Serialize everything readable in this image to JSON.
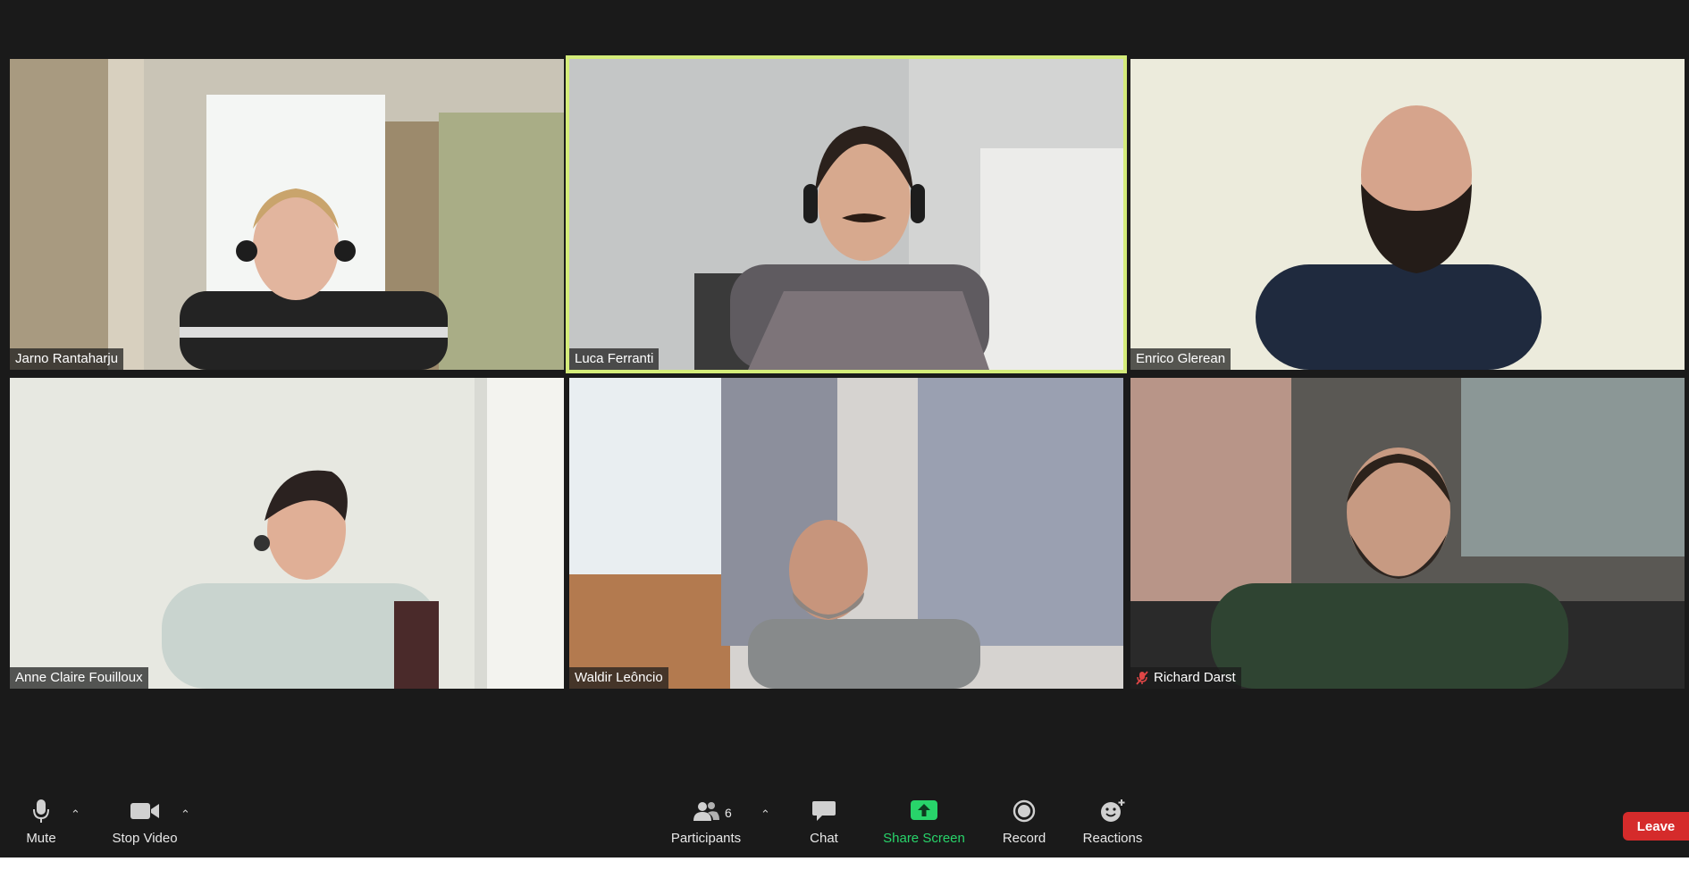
{
  "participants": [
    {
      "name": "Jarno Rantaharju",
      "muted": false,
      "speaking": false
    },
    {
      "name": "Luca Ferranti",
      "muted": false,
      "speaking": true
    },
    {
      "name": "Enrico Glerean",
      "muted": false,
      "speaking": false
    },
    {
      "name": "Anne Claire Fouilloux",
      "muted": false,
      "speaking": false
    },
    {
      "name": "Waldir Leôncio",
      "muted": false,
      "speaking": false
    },
    {
      "name": "Richard Darst",
      "muted": true,
      "speaking": false
    }
  ],
  "toolbar": {
    "mute_label": "Mute",
    "stop_video_label": "Stop Video",
    "participants_label": "Participants",
    "participants_count": "6",
    "chat_label": "Chat",
    "share_screen_label": "Share Screen",
    "record_label": "Record",
    "reactions_label": "Reactions",
    "leave_label": "Leave"
  },
  "colors": {
    "background": "#1a1a1a",
    "speaking_outline": "#d4ec7a",
    "share_green": "#28d46a",
    "leave_red": "#d52b2b"
  },
  "icons": [
    "microphone-icon",
    "video-camera-icon",
    "participants-icon",
    "chat-icon",
    "share-screen-icon",
    "record-icon",
    "reactions-icon",
    "muted-mic-icon",
    "caret-up-icon"
  ]
}
